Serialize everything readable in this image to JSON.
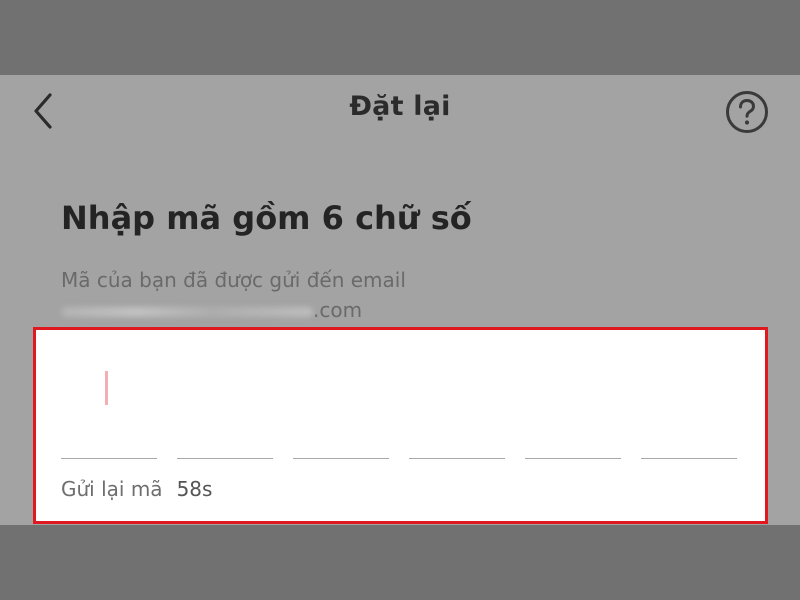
{
  "header": {
    "title": "Đặt lại",
    "back_icon": "chevron-left-icon",
    "help_icon": "question-circle-icon"
  },
  "main": {
    "heading": "Nhập mã gồm 6 chữ số",
    "subtext": "Mã của bạn đã được gửi đến email",
    "email_visible_suffix": ".com",
    "code_input": {
      "digit_count": 6,
      "values": [
        "",
        "",
        "",
        "",
        "",
        ""
      ],
      "highlight_color": "#e0181f",
      "cursor_color": "#f2aeb4"
    },
    "resend": {
      "label": "Gửi lại mã",
      "countdown": "58s"
    }
  },
  "colors": {
    "overlay_background": "#a3a3a3",
    "outer_background": "#717171"
  }
}
